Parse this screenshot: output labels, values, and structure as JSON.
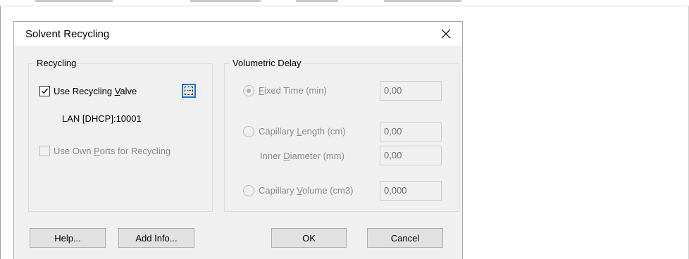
{
  "dialog": {
    "title": "Solvent Recycling",
    "close_icon": "close-icon"
  },
  "recycling_group": {
    "title": "Recycling",
    "use_recycling_valve": {
      "label_pre": "Use Recycling ",
      "label_key": "V",
      "label_post": "alve",
      "checked": true
    },
    "browse_button_icon": "ellipsis-icon",
    "connection_text": "LAN [DHCP]:10001",
    "use_own_ports": {
      "label_pre": "Use Own ",
      "label_key": "P",
      "label_post": "orts for Recycling",
      "checked": false,
      "enabled": false
    }
  },
  "volumetric_group": {
    "title": "Volumetric Delay",
    "fixed_time": {
      "label_key": "F",
      "label_post": "ixed Time (min)",
      "selected": true,
      "value": "0,00"
    },
    "capillary_length": {
      "label_pre": "Capillary ",
      "label_key": "L",
      "label_post": "ength (cm)",
      "selected": false,
      "value": "0,00"
    },
    "inner_diameter": {
      "label_pre": "Inner ",
      "label_key": "D",
      "label_post": "iameter (mm)",
      "value": "0,00"
    },
    "capillary_volume": {
      "label_pre": "Capillary ",
      "label_key": "V",
      "label_post": "olume (cm3)",
      "selected": false,
      "value": "0,000"
    }
  },
  "buttons": {
    "help": "Help...",
    "add_info": "Add Info...",
    "ok": "OK",
    "cancel": "Cancel"
  },
  "colors": {
    "dialog_bg": "#f0f0f0",
    "focus_accent": "#1976d2",
    "disabled_text": "#8a8a8a"
  }
}
